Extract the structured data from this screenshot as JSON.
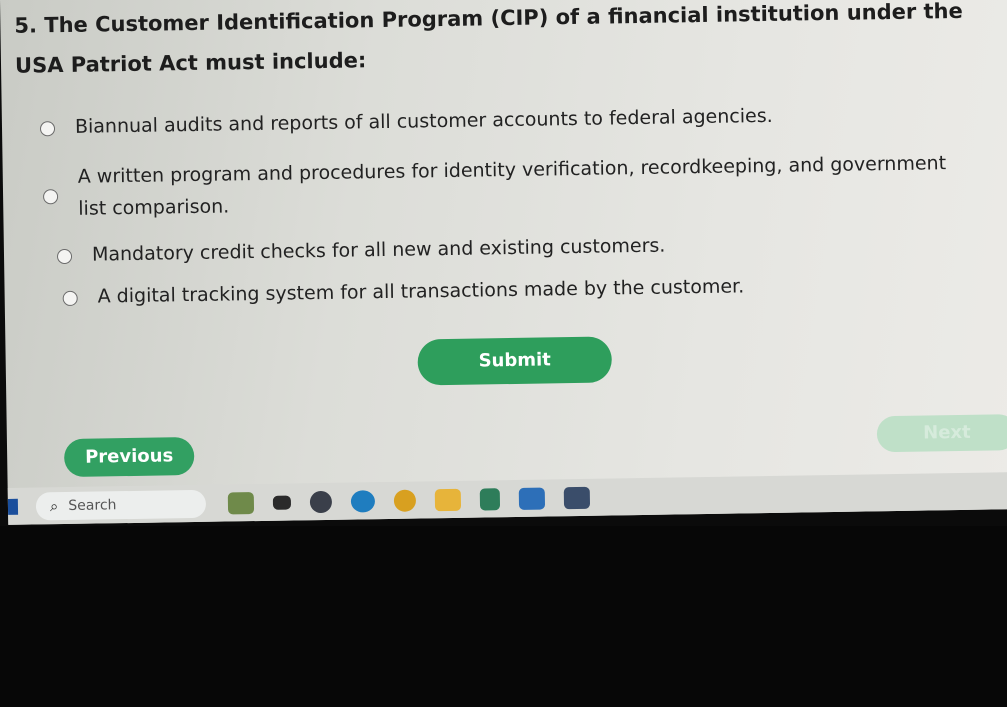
{
  "question": {
    "text": "5. The Customer Identification Program (CIP) of a financial institution under the USA Patriot Act must include:"
  },
  "options": [
    {
      "label": "Biannual audits and reports of all customer accounts to federal agencies."
    },
    {
      "label": "A written program and procedures for identity verification, recordkeeping, and government list comparison."
    },
    {
      "label": "Mandatory credit checks for all new and existing customers."
    },
    {
      "label": "A digital tracking system for all transactions made by the customer."
    }
  ],
  "buttons": {
    "submit": "Submit",
    "previous": "Previous",
    "next": "Next"
  },
  "taskbar": {
    "search_label": "Search",
    "icons": [
      "widgets-icon",
      "taskview-icon",
      "copilot-icon",
      "edge-icon",
      "chrome-icon",
      "file-explorer-icon",
      "store-icon",
      "teams-icon",
      "app-icon"
    ]
  },
  "colors": {
    "accent": "#2e9e5c",
    "next_disabled": "#bfe0c8"
  }
}
